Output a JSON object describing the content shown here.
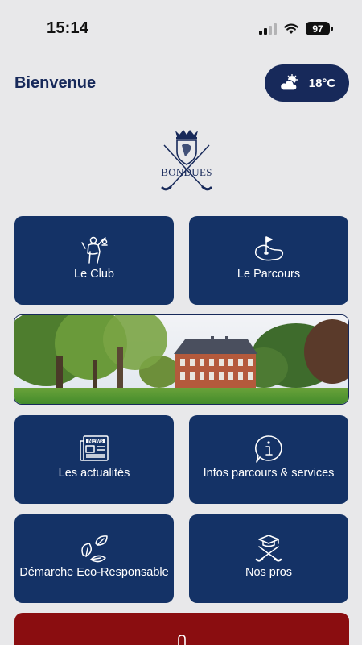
{
  "status_bar": {
    "time": "15:14",
    "battery": "97",
    "icons": [
      "cellular-signal-icon",
      "wifi-icon",
      "battery-icon"
    ]
  },
  "header": {
    "title": "Bienvenue",
    "weather": {
      "icon": "cloud-sun-icon",
      "temperature": "18°C"
    }
  },
  "logo": {
    "text": "BONDUES"
  },
  "tiles": [
    {
      "label": "Le Club",
      "icon": "golfer-icon"
    },
    {
      "label": "Le Parcours",
      "icon": "golf-green-flag-icon"
    },
    {
      "label": "Les actualités",
      "icon": "news-icon"
    },
    {
      "label": "Infos parcours & services",
      "icon": "info-bubble-icon"
    },
    {
      "label": "Démarche Eco-Responsable",
      "icon": "leaves-icon"
    },
    {
      "label": "Nos pros",
      "icon": "graduation-clubs-icon"
    }
  ],
  "banner": {
    "image": "chateau-golf-course-photo"
  },
  "colors": {
    "background": "#e8e8ea",
    "primary": "#143266",
    "accent_red": "#8a0d10",
    "text_dark": "#17295a"
  }
}
